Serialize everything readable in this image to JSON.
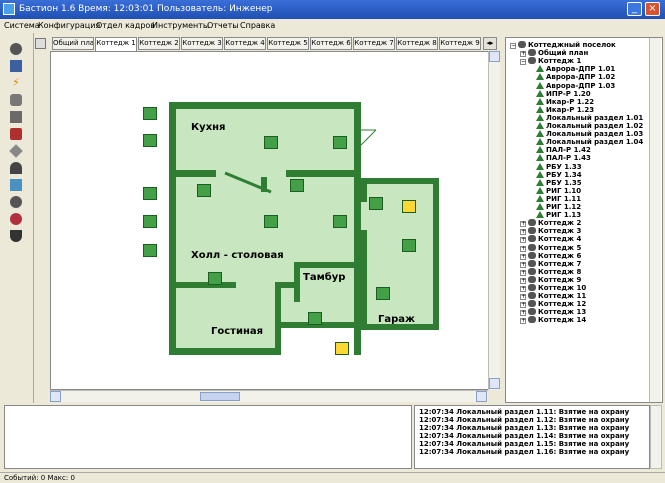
{
  "window": {
    "title": "Бастион 1.6 Время: 12:03:01 Пользователь: Инженер"
  },
  "menu": [
    "Система",
    "Конфигурация",
    "Отдел кадров",
    "Инструменты",
    "Отчеты",
    "Справка"
  ],
  "left_toolbar_icons": [
    "camera-icon",
    "plan-icon",
    "lightning-icon",
    "lock-icon",
    "card-reader-icon",
    "access-icon",
    "chip-icon",
    "key-icon",
    "eye-icon",
    "gear-icon",
    "person-icon",
    "report-icon"
  ],
  "tabs": [
    "Общий план",
    "Коттедж 1",
    "Коттедж 2",
    "Коттедж 3",
    "Коттедж 4",
    "Коттедж 5",
    "Коттедж 6",
    "Коттедж 7",
    "Коттедж 8",
    "Коттедж 9"
  ],
  "active_tab": "Коттедж 1",
  "plan": {
    "rooms": [
      "Кухня",
      "Холл - столовая",
      "Тамбур",
      "Гостиная",
      "Гараж"
    ],
    "colors": {
      "wall": "#2e7d32",
      "floor": "#c8e6c0",
      "sensor": "#4caf50",
      "sensor_alarm": "#fdd835"
    }
  },
  "tree": {
    "root": "Коттеджный поселок",
    "general_plan": "Общий план",
    "cottage1": "Коттедж 1",
    "cottage1_children": [
      "Аврора-ДПР 1.01",
      "Аврора-ДПР 1.02",
      "Аврора-ДПР 1.03",
      "ИПР-Р 1.20",
      "Икар-Р 1.22",
      "Икар-Р 1.23",
      "Локальный раздел 1.01",
      "Локальный раздел 1.02",
      "Локальный раздел 1.03",
      "Локальный раздел 1.04",
      "ПАЛ-Р 1.42",
      "ПАЛ-Р 1.43",
      "РБУ 1.33",
      "РБУ 1.34",
      "РБУ 1.35",
      "РИГ 1.10",
      "РИГ 1.11",
      "РИГ 1.12",
      "РИГ 1.13"
    ],
    "cottages": [
      "Коттедж 2",
      "Коттедж 3",
      "Коттедж 4",
      "Коттедж 5",
      "Коттедж 6",
      "Коттедж 7",
      "Коттедж 8",
      "Коттедж 9",
      "Коттедж 10",
      "Коттедж 11",
      "Коттедж 12",
      "Коттедж 13",
      "Коттедж 14"
    ]
  },
  "messages": [
    "12:07:34 Локальный раздел 1.11: Взятие на охрану",
    "12:07:34 Локальный раздел 1.12: Взятие на охрану",
    "12:07:34 Локальный раздел 1.13: Взятие на охрану",
    "12:07:34 Локальный раздел 1.14: Взятие на охрану",
    "12:07:34 Локальный раздел 1.15: Взятие на охрану",
    "12:07:34 Локальный раздел 1.16: Взятие на охрану"
  ],
  "status": "Событий: 0 Макс: 0"
}
